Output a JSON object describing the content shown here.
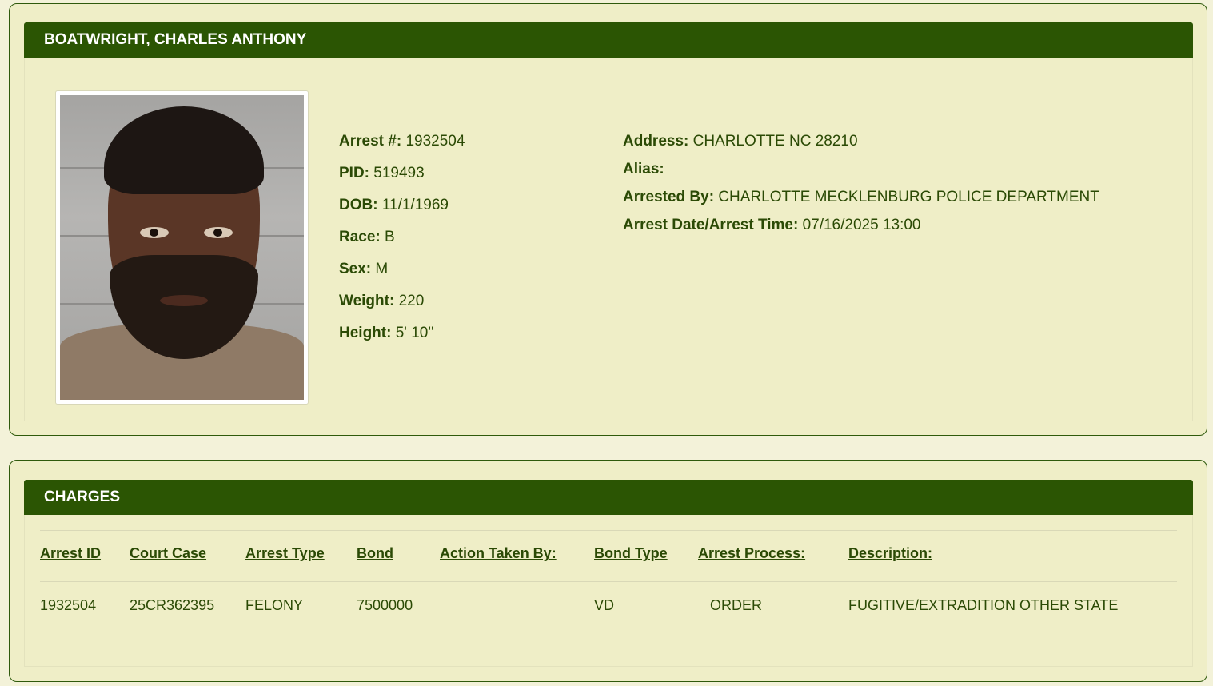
{
  "profile": {
    "name": "BOATWRIGHT, CHARLES ANTHONY",
    "left_fields": [
      {
        "label": "Arrest #:",
        "value": "1932504"
      },
      {
        "label": "PID:",
        "value": "519493"
      },
      {
        "label": "DOB:",
        "value": "11/1/1969"
      },
      {
        "label": "Race:",
        "value": "B"
      },
      {
        "label": "Sex:",
        "value": "M"
      },
      {
        "label": "Weight:",
        "value": "220"
      },
      {
        "label": "Height:",
        "value": "5' 10''"
      }
    ],
    "right_fields": [
      {
        "label": "Address:",
        "value": "CHARLOTTE NC 28210"
      },
      {
        "label": "Alias:",
        "value": ""
      },
      {
        "label": "Arrested By:",
        "value": "CHARLOTTE MECKLENBURG POLICE DEPARTMENT"
      },
      {
        "label": "Arrest Date/Arrest Time:",
        "value": "07/16/2025 13:00"
      }
    ]
  },
  "charges": {
    "title": "CHARGES",
    "columns": [
      "Arrest ID",
      "Court Case",
      "Arrest Type",
      "Bond",
      "Action Taken By:",
      "Bond Type",
      "Arrest Process:",
      "Description:"
    ],
    "rows": [
      [
        "1932504",
        "25CR362395",
        "FELONY",
        "7500000",
        "",
        "VD",
        "ORDER",
        "FUGITIVE/EXTRADITION OTHER STATE"
      ]
    ]
  },
  "colors": {
    "header_bg": "#2b5503",
    "card_bg": "#efeec7",
    "text": "#2b4a05"
  }
}
